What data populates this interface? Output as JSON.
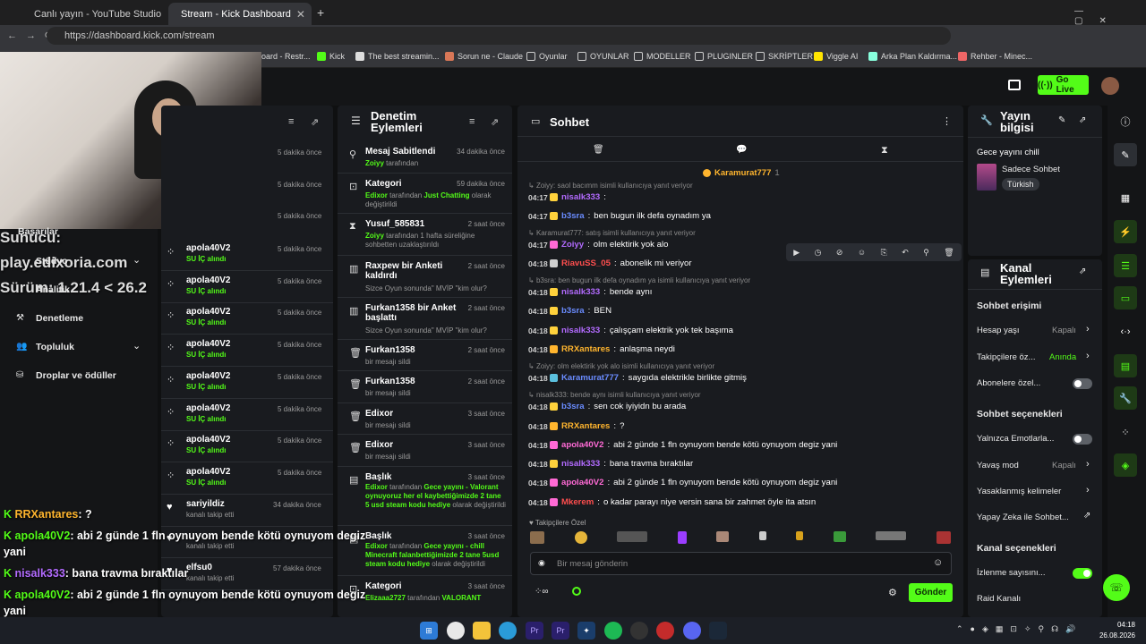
{
  "browser": {
    "tabs": [
      {
        "label": "Canlı yayın - YouTube Studio"
      },
      {
        "label": "Stream - Kick Dashboard"
      }
    ],
    "url": "https://dashboard.kick.com/stream",
    "bookmarks": [
      "oard - Restr...",
      "Kick",
      "The best streamin...",
      "Sorun ne - Claude",
      "Oyunlar",
      "OYUNLAR",
      "MODELLER",
      "PLUGINLER",
      "SKRİPTLER",
      "Viggle AI",
      "Arka Plan Kaldırma...",
      "Rehber - Minec..."
    ]
  },
  "header": {
    "go_live": "Go Live"
  },
  "nav": {
    "items": [
      "Başarılar",
      "Stüdyo",
      "Analitik",
      "Denetleme",
      "Topluluk",
      "Droplar ve ödüller"
    ]
  },
  "overlay": {
    "server_line1": "Sunucu:",
    "server_line2": "play.edixoria.com",
    "server_line3": "Sürüm: 1.21.4 < 26.2"
  },
  "activity": {
    "time_top": [
      "5 dakika önce",
      "5 dakika önce",
      "5 dakika önce"
    ],
    "rows": [
      {
        "user": "apola40V2",
        "sub": "SU İÇ alındı",
        "time": "5 dakika önce"
      },
      {
        "user": "apola40V2",
        "sub": "SU İÇ alındı",
        "time": "5 dakika önce"
      },
      {
        "user": "apola40V2",
        "sub": "SU İÇ alındı",
        "time": "5 dakika önce"
      },
      {
        "user": "apola40V2",
        "sub": "SU İÇ alındı",
        "time": "5 dakika önce"
      },
      {
        "user": "apola40V2",
        "sub": "SU İÇ alındı",
        "time": "5 dakika önce"
      },
      {
        "user": "apola40V2",
        "sub": "SU İÇ alındı",
        "time": "5 dakika önce"
      },
      {
        "user": "apola40V2",
        "sub": "SU İÇ alındı",
        "time": "5 dakika önce"
      },
      {
        "user": "apola40V2",
        "sub": "SU İÇ alındı",
        "time": "5 dakika önce"
      },
      {
        "user": "sariyildiz",
        "sub": "kanalı takip etti",
        "time": "34 dakika önce"
      },
      {
        "user": "",
        "sub": "kanalı takip etti",
        "time": ""
      },
      {
        "user": "elfsu0",
        "sub": "kanalı takip etti",
        "time": "57 dakika önce"
      }
    ]
  },
  "mod": {
    "title": "Denetim Eylemleri",
    "rows": [
      {
        "title": "Mesaj Sabitlendi",
        "who": "Zoiyy",
        "rest": "tarafından",
        "time": "34 dakika önce"
      },
      {
        "title": "Kategori",
        "who": "Edixor",
        "rest": "tarafından",
        "extra": "Just Chatting",
        "rest2": "olarak değiştirildi",
        "time": "59 dakika önce"
      },
      {
        "title": "Yusuf_585831",
        "who": "Zoiyy",
        "rest": "tarafından 1 hafta süreliğine sohbetten uzaklaştırıldı",
        "time": "2 saat önce"
      },
      {
        "title": "Raxpew bir Anketi kaldırdı",
        "who": "",
        "rest": "Sizce Oyun sonunda\" MVİP \"kim olur?",
        "time": "2 saat önce"
      },
      {
        "title": "Furkan1358 bir Anket başlattı",
        "who": "",
        "rest": "Sizce Oyun sonunda\" MVİP \"kim olur?",
        "time": "2 saat önce"
      },
      {
        "title": "Furkan1358",
        "who": "",
        "rest": "bir mesajı sildi",
        "time": "2 saat önce"
      },
      {
        "title": "Furkan1358",
        "who": "",
        "rest": "bir mesajı sildi",
        "time": "2 saat önce"
      },
      {
        "title": "Edixor",
        "who": "",
        "rest": "bir mesajı sildi",
        "time": "3 saat önce"
      },
      {
        "title": "Edixor",
        "who": "",
        "rest": "bir mesajı sildi",
        "time": "3 saat önce"
      },
      {
        "title": "Başlık",
        "who": "Edixor",
        "rest": "tarafından",
        "extra": "Gece yayını - Valorant oynuyoruz her el kaybettiğimizde 2 tane 5 usd steam kodu hediye",
        "rest2": "olarak değiştirildi",
        "time": "3 saat önce"
      },
      {
        "title": "Başlık",
        "who": "Edixor",
        "rest": "tarafından",
        "extra": "Gece yayını - chill Minecraft falanbettiğimizde 2 tane 5usd steam kodu hediye",
        "rest2": "olarak değiştirildi",
        "time": "3 saat önce"
      },
      {
        "title": "Kategori",
        "who": "Elizaaa2727",
        "rest": "tarafından",
        "extra": "VALORANT",
        "rest2": "",
        "time": "3 saat önce"
      }
    ]
  },
  "chat": {
    "title": "Sohbet",
    "pinned_user": "Karamurat777",
    "pinned_count": "1",
    "messages": [
      {
        "reply": "Zoiyy: saol bacımm isimli kullanıcıya yanıt veriyor",
        "time": "04:17",
        "user": "nisalk333",
        "color": "#b36bff",
        "text": ""
      },
      {
        "time": "04:17",
        "user": "b3sra",
        "color": "#6a8cff",
        "text": "ben bugun ilk defa oynadım ya"
      },
      {
        "reply": "Karamurat777: satış isimli kullanıcıya yanıt veriyor",
        "time": "04:17",
        "user": "Zoiyy",
        "color": "#b36bff",
        "text": "olm elektirik yok alo"
      },
      {
        "time": "04:18",
        "user": "RiavuSS_05",
        "color": "#ff4e4e",
        "text": "abonelik mi veriyor"
      },
      {
        "reply": "b3sra: ben bugun ilk defa oynadım ya isimli kullanıcıya yanıt veriyor",
        "time": "04:18",
        "user": "nisalk333",
        "color": "#b36bff",
        "text": "bende aynı"
      },
      {
        "time": "04:18",
        "user": "b3sra",
        "color": "#6a8cff",
        "text": "BEN"
      },
      {
        "time": "04:18",
        "user": "nisalk333",
        "color": "#b36bff",
        "text": "çalışçam elektrik yok tek başıma"
      },
      {
        "time": "04:18",
        "user": "RRXantares",
        "color": "#ffb52e",
        "text": "anlaşma neydi"
      },
      {
        "reply": "Zoiyy: olm elektirik yok alo isimli kullanıcıya yanıt veriyor",
        "time": "04:18",
        "user": "Karamurat777",
        "color": "#6a8cff",
        "text": "saygıda elektrikle birlikte gitmiş"
      },
      {
        "reply": "nisalk333: bende aynı isimli kullanıcıya yanıt veriyor",
        "time": "04:18",
        "user": "b3sra",
        "color": "#6a8cff",
        "text": "sen cok iyiyidn bu arada"
      },
      {
        "time": "04:18",
        "user": "RRXantares",
        "color": "#ffb52e",
        "text": "?"
      },
      {
        "time": "04:18",
        "user": "apola40V2",
        "color": "#ff6ad5",
        "text": "abi 2 günde 1 fln oynuyom bende kötü oynuyom degiz yani"
      },
      {
        "time": "04:18",
        "user": "nisalk333",
        "color": "#b36bff",
        "text": "bana travma bıraktılar"
      },
      {
        "time": "04:18",
        "user": "apola40V2",
        "color": "#ff6ad5",
        "text": "abi 2 günde 1 fln oynuyom bende kötü oynuyom degiz yani"
      },
      {
        "time": "04:18",
        "user": "Mkerem",
        "color": "#ff4e4e",
        "text": "o kadar parayı niye versin sana bir zahmet öyle ita atsın"
      }
    ],
    "follower_label": "Takipçilere Özel",
    "input_placeholder": "Bir mesaj gönderin",
    "send": "Gönder"
  },
  "stream_info": {
    "title": "Yayın bilgisi",
    "stream_title": "Gece yayını chill",
    "category": "Sadece Sohbet",
    "tag": "Türkish"
  },
  "channel": {
    "title": "Kanal Eylemleri",
    "access": "Sohbet erişimi",
    "account_age": "Hesap yaşı",
    "account_age_val": "Kapalı",
    "followers": "Takipçilere öz...",
    "followers_val": "Anında",
    "subs": "Abonelere özel...",
    "options": "Sohbet seçenekleri",
    "emote": "Yalnızca Emotlarla...",
    "slow": "Yavaş mod",
    "slow_val": "Kapalı",
    "banned": "Yasaklanmış kelimeler",
    "ai": "Yapay Zeka ile Sohbet...",
    "ch_opts": "Kanal seçenekleri",
    "views": "İzlenme sayısını...",
    "raid": "Raid Kanalı"
  },
  "obs_chat": [
    {
      "user": "RRXantares",
      "color": "#ffb52e",
      "text": ": ?"
    },
    {
      "user": "apola40V2",
      "color": "#53fc18",
      "text": ": abi 2 günde 1 fln oynuyom bende kötü oynuyom degiz"
    },
    {
      "user": "",
      "color": "#fff",
      "text": "yani"
    },
    {
      "user": "nisalk333",
      "color": "#b36bff",
      "text": ": bana travma bıraktılar"
    },
    {
      "user": "apola40V2",
      "color": "#53fc18",
      "text": ": abi 2 günde 1 fln oynuyom bende kötü oynuyom degiz"
    },
    {
      "user": "",
      "color": "#fff",
      "text": "yani"
    },
    {
      "user": "Mkerem",
      "color": "#ff4e4e",
      "text": ": o kadar parayı niye versin sana bir zahmet öyle ita atsın"
    }
  ],
  "clock": {
    "time": "04:18",
    "date": "26.08.2026"
  }
}
